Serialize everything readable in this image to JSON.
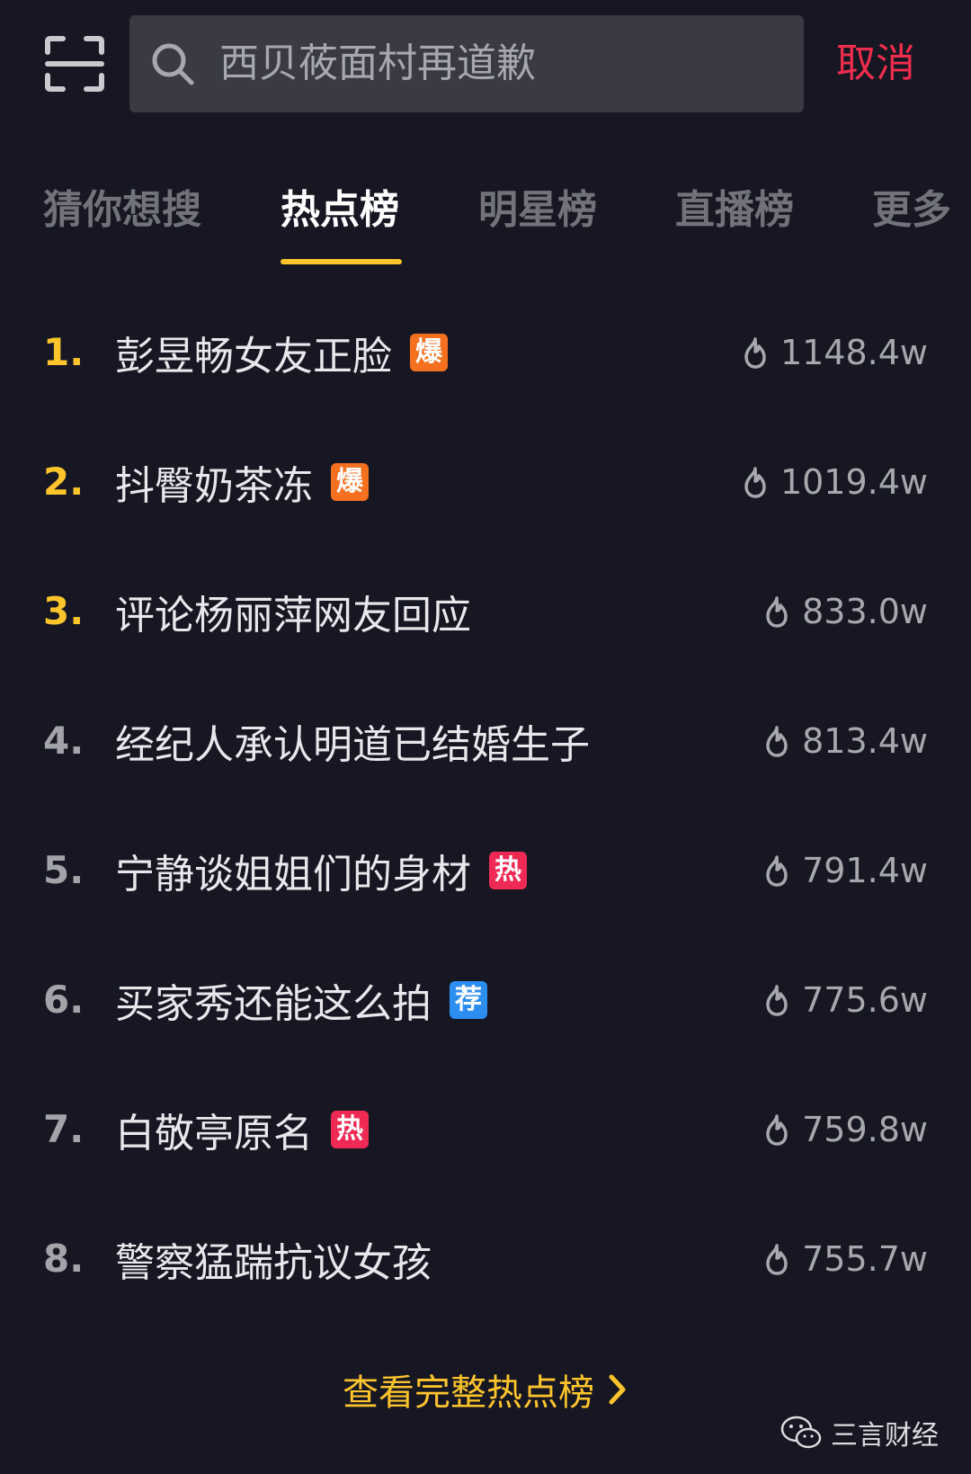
{
  "search": {
    "query": "西贝莜面村再道歉",
    "cancel_label": "取消"
  },
  "tabs": [
    {
      "label": "猜你想搜",
      "active": false
    },
    {
      "label": "热点榜",
      "active": true
    },
    {
      "label": "明星榜",
      "active": false
    },
    {
      "label": "直播榜",
      "active": false
    },
    {
      "label": "更多",
      "active": false
    }
  ],
  "hot_list": [
    {
      "rank": "1.",
      "title": "彭昱畅女友正脸",
      "badge": "爆",
      "badge_color": "#f5701f",
      "heat": "1148.4w"
    },
    {
      "rank": "2.",
      "title": "抖臀奶茶冻",
      "badge": "爆",
      "badge_color": "#f5701f",
      "heat": "1019.4w"
    },
    {
      "rank": "3.",
      "title": "评论杨丽萍网友回应",
      "badge": "",
      "badge_color": "",
      "heat": "833.0w"
    },
    {
      "rank": "4.",
      "title": "经纪人承认明道已结婚生子",
      "badge": "",
      "badge_color": "",
      "heat": "813.4w"
    },
    {
      "rank": "5.",
      "title": "宁静谈姐姐们的身材",
      "badge": "热",
      "badge_color": "#ee2a54",
      "heat": "791.4w"
    },
    {
      "rank": "6.",
      "title": "买家秀还能这么拍",
      "badge": "荐",
      "badge_color": "#2d8ef2",
      "heat": "775.6w"
    },
    {
      "rank": "7.",
      "title": "白敬亭原名",
      "badge": "热",
      "badge_color": "#ee2a54",
      "heat": "759.8w"
    },
    {
      "rank": "8.",
      "title": "警察猛踹抗议女孩",
      "badge": "",
      "badge_color": "",
      "heat": "755.7w"
    }
  ],
  "footer": {
    "more_label": "查看完整热点榜"
  },
  "watermark": {
    "text": "三言财经"
  },
  "colors": {
    "background": "#161722",
    "accent_yellow": "#fdc42c",
    "cancel_red": "#f12d4e",
    "search_bg": "#393a43"
  },
  "icons": {
    "scan": "scan-icon",
    "search": "search-icon",
    "heat": "fire-icon",
    "more": "chevron-right-icon",
    "watermark": "wechat-icon"
  }
}
